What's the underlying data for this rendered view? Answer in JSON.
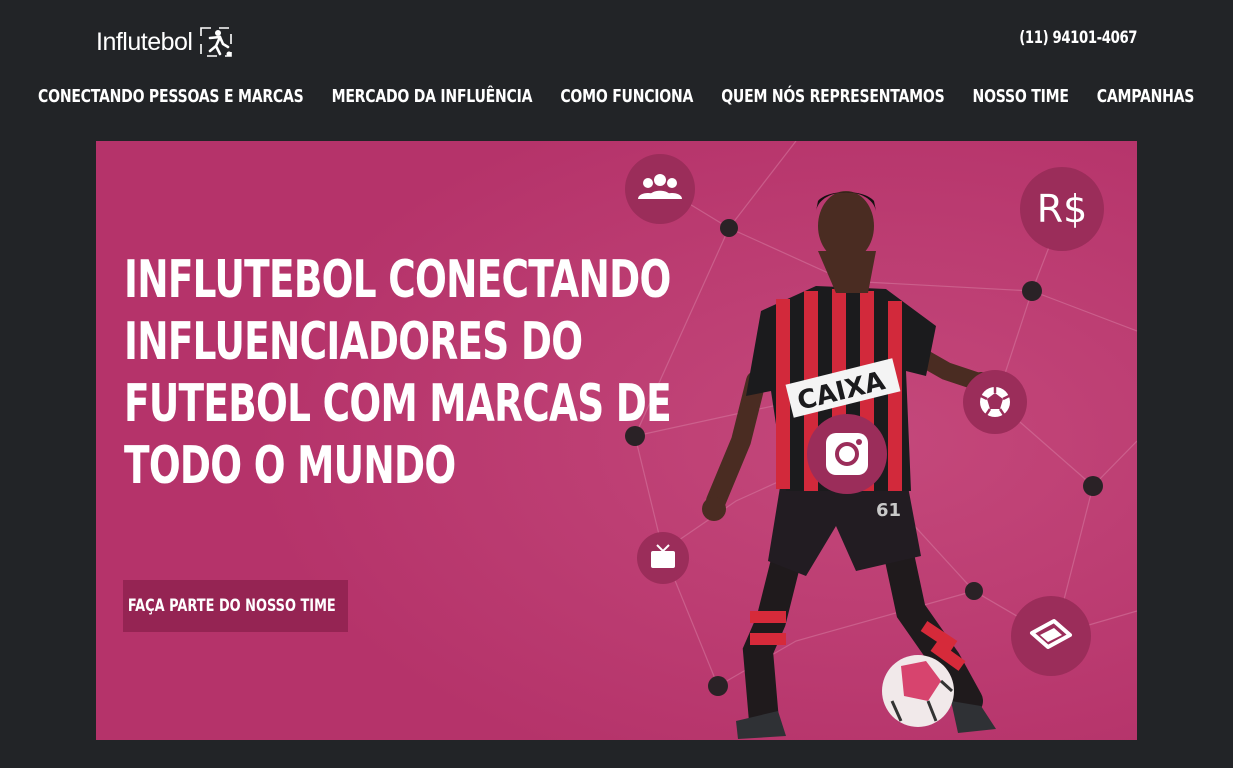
{
  "header": {
    "logo_text": "Influtebol",
    "phone": "(11) 94101-4067"
  },
  "nav": {
    "items": [
      {
        "label": "CONECTANDO PESSOAS E MARCAS"
      },
      {
        "label": "MERCADO DA INFLUÊNCIA"
      },
      {
        "label": "COMO FUNCIONA"
      },
      {
        "label": "QUEM NÓS REPRESENTAMOS"
      },
      {
        "label": "NOSSO TIME"
      },
      {
        "label": "CAMPANHAS"
      }
    ]
  },
  "hero": {
    "title": "INFLUTEBOL CONECTANDO INFLUENCIADORES DO FUTEBOL COM MARCAS DE TODO O MUNDO",
    "cta_label": "FAÇA PARTE DO NOSSO TIME",
    "currency_badge": "R$",
    "shirt_text": "CAIXA",
    "accent_color": "#b5336a",
    "cta_color": "#952453"
  },
  "icons": {
    "people": "people-group-icon",
    "money": "currency-icon",
    "ball": "soccer-ball-icon",
    "instagram": "instagram-icon",
    "tv": "tv-icon",
    "ticket": "ticket-icon",
    "whatsapp": "whatsapp-icon"
  }
}
